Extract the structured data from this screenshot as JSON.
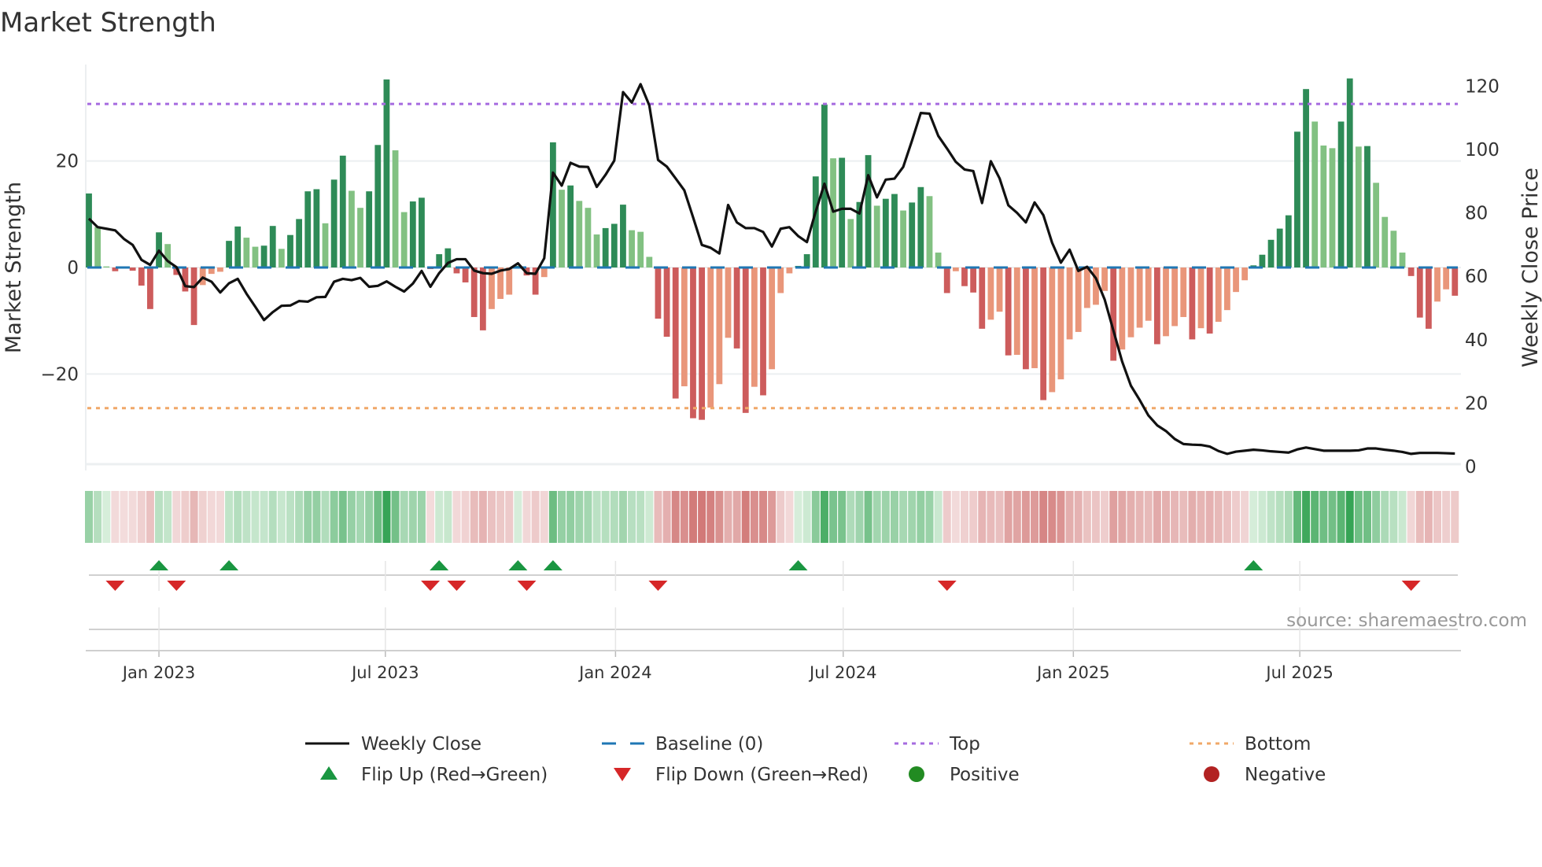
{
  "title": "Market Strength",
  "source": "source: sharemaestro.com",
  "colors": {
    "bar_pos_rising": "#2e8b57",
    "bar_pos_falling": "#82c182",
    "bar_neg_falling": "#cd5c5c",
    "bar_neg_rising": "#e9967a",
    "close_line": "#111111",
    "baseline": "#1f77b4",
    "top": "#a66be0",
    "bottom": "#f0a868",
    "flip_up": "#1a9641",
    "flip_down": "#d62728",
    "positive": "#228b22",
    "negative": "#b22222"
  },
  "legend": [
    {
      "label": "Weekly Close",
      "icon": "solid-line"
    },
    {
      "label": "Baseline (0)",
      "icon": "dashed-line"
    },
    {
      "label": "Top",
      "icon": "dotted-line-purple"
    },
    {
      "label": "Bottom",
      "icon": "dotted-line-orange"
    },
    {
      "label": "Flip Up (Red→Green)",
      "icon": "triangle-up"
    },
    {
      "label": "Flip Down (Green→Red)",
      "icon": "triangle-down"
    },
    {
      "label": "Positive",
      "icon": "circle-green"
    },
    {
      "label": "Negative",
      "icon": "circle-red"
    }
  ],
  "chart_data": {
    "type": "bar+line",
    "title": "Market Strength",
    "ylabel": "Market Strength",
    "y2label": "Weekly Close Price",
    "ylim": [
      -37,
      39.5
    ],
    "y2lim": [
      0,
      124
    ],
    "yticks": [
      {
        "value": 20,
        "label": "20"
      },
      {
        "value": 0,
        "label": "0"
      },
      {
        "value": -20,
        "label": "−20"
      }
    ],
    "y2ticks": [
      {
        "value": 120,
        "label": "120"
      },
      {
        "value": 100,
        "label": "100"
      },
      {
        "value": 80,
        "label": "80"
      },
      {
        "value": 60,
        "label": "60"
      },
      {
        "value": 40,
        "label": "40"
      },
      {
        "value": 20,
        "label": "20"
      },
      {
        "value": 0,
        "label": "0"
      }
    ],
    "start_date": "2022-11-06",
    "frequency": "weekly",
    "xticks": [
      {
        "date": "2023-01-01",
        "label": "Jan 2023"
      },
      {
        "date": "2023-07-01",
        "label": "Jul 2023"
      },
      {
        "date": "2024-01-01",
        "label": "Jan 2024"
      },
      {
        "date": "2024-07-01",
        "label": "Jul 2024"
      },
      {
        "date": "2025-01-01",
        "label": "Jan 2025"
      },
      {
        "date": "2025-07-01",
        "label": "Jul 2025"
      }
    ],
    "top": 30.7,
    "bottom": -26.4,
    "baseline": 0,
    "strength": [
      13.9,
      7.6,
      0.2,
      -0.7,
      -0.1,
      -0.6,
      -3.4,
      -7.8,
      6.6,
      4.4,
      -1.4,
      -4.5,
      -10.8,
      -3.3,
      -1.2,
      -0.8,
      5.0,
      7.7,
      5.6,
      3.9,
      4.1,
      7.8,
      3.5,
      6.1,
      9.1,
      14.3,
      14.7,
      8.3,
      16.5,
      21.0,
      14.4,
      11.2,
      14.3,
      23.0,
      35.3,
      22.0,
      10.4,
      12.4,
      13.1,
      -0.3,
      2.5,
      3.6,
      -1.1,
      -2.8,
      -9.3,
      -11.8,
      -7.8,
      -5.9,
      -5.1,
      0.3,
      -1.5,
      -5.1,
      -1.8,
      23.5,
      14.6,
      15.4,
      12.5,
      11.2,
      6.2,
      7.4,
      8.2,
      11.8,
      7.0,
      6.7,
      2.0,
      -9.6,
      -13.0,
      -24.6,
      -22.3,
      -28.3,
      -28.6,
      -26.3,
      -21.9,
      -13.2,
      -15.2,
      -27.3,
      -22.4,
      -24.0,
      -19.1,
      -4.8,
      -1.1,
      0.3,
      2.5,
      17.1,
      30.6,
      20.5,
      20.6,
      9.1,
      12.3,
      21.1,
      11.6,
      12.9,
      13.8,
      10.7,
      12.2,
      15.1,
      13.4,
      2.8,
      -4.8,
      -0.7,
      -3.5,
      -4.7,
      -11.5,
      -9.8,
      -8.3,
      -16.5,
      -16.4,
      -19.1,
      -18.9,
      -24.9,
      -23.4,
      -21.0,
      -13.5,
      -12.1,
      -7.6,
      -7.0,
      -4.4,
      -17.5,
      -15.4,
      -13.1,
      -11.3,
      -10.0,
      -14.4,
      -12.9,
      -11.0,
      -9.3,
      -13.5,
      -11.4,
      -12.4,
      -10.2,
      -8.0,
      -4.6,
      -2.4,
      0.4,
      2.4,
      5.2,
      7.3,
      9.8,
      25.5,
      33.5,
      27.4,
      22.9,
      22.4,
      27.4,
      35.5,
      22.7,
      22.8,
      15.9,
      9.5,
      6.9,
      2.8,
      -1.6,
      -9.4,
      -11.5,
      -6.4,
      -4.1,
      -5.3
    ],
    "weekly_close": [
      78.2,
      75.5,
      75.0,
      74.5,
      71.8,
      69.9,
      65.2,
      63.6,
      68.1,
      64.8,
      62.9,
      56.9,
      56.6,
      59.6,
      58.3,
      54.9,
      57.8,
      59.2,
      54.5,
      50.4,
      46.2,
      48.7,
      50.7,
      50.8,
      52.2,
      52.0,
      53.4,
      53.5,
      58.3,
      59.2,
      58.8,
      59.5,
      56.7,
      57.0,
      58.4,
      56.7,
      55.2,
      57.7,
      61.7,
      56.7,
      61.0,
      64.2,
      65.4,
      65.4,
      61.8,
      61.0,
      60.8,
      61.8,
      62.3,
      64.1,
      61.0,
      60.8,
      65.7,
      92.7,
      88.6,
      95.8,
      94.6,
      94.5,
      88.2,
      92.0,
      96.5,
      118.1,
      114.8,
      120.6,
      113.9,
      96.7,
      94.6,
      90.9,
      87.1,
      78.6,
      69.9,
      69.0,
      67.2,
      82.5,
      77.0,
      75.2,
      75.2,
      74.0,
      69.4,
      75.0,
      75.5,
      72.7,
      70.8,
      80.4,
      89.2,
      80.4,
      81.3,
      81.3,
      79.8,
      91.9,
      84.9,
      90.5,
      90.8,
      94.5,
      102.8,
      111.5,
      111.3,
      104.3,
      100.3,
      96.1,
      93.7,
      93.2,
      83.1,
      96.3,
      90.9,
      82.4,
      80.0,
      77.0,
      83.3,
      79.3,
      70.6,
      64.3,
      68.4,
      61.7,
      63.0,
      59.4,
      52.7,
      42.9,
      33.1,
      25.5,
      21.0,
      16.1,
      13.0,
      11.2,
      8.7,
      7.1,
      6.9,
      6.8,
      6.3,
      4.9,
      4.0,
      4.7,
      5.0,
      5.3,
      5.1,
      4.8,
      4.6,
      4.4,
      5.4,
      6.0,
      5.5,
      5.0,
      5.0,
      5.0,
      5.0,
      5.1,
      5.7,
      5.7,
      5.3,
      5.0,
      4.6,
      4.0,
      4.3,
      4.3,
      4.3,
      4.2,
      4.1
    ],
    "legend_position": "bottom",
    "grid": true
  }
}
